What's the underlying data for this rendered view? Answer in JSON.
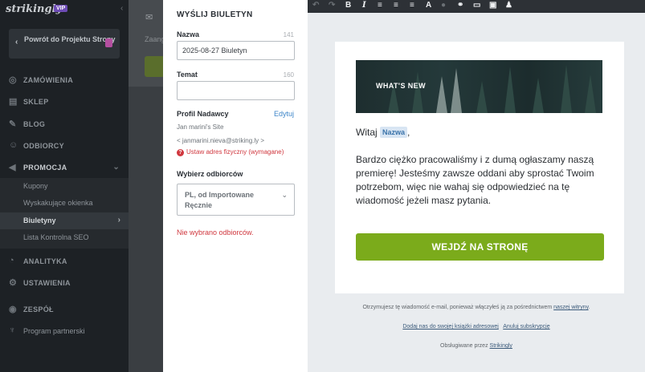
{
  "brand": {
    "name": "strikingly",
    "badge": "VIP"
  },
  "sidebar": {
    "back_label": "Powrót do Projektu Strony",
    "items": [
      {
        "label": "ZAMÓWIENIA",
        "icon": "dollar-icon"
      },
      {
        "label": "SKLEP",
        "icon": "shop-icon"
      },
      {
        "label": "BLOG",
        "icon": "pen-icon"
      },
      {
        "label": "ODBIORCY",
        "icon": "users-icon"
      },
      {
        "label": "PROMOCJA",
        "icon": "megaphone-icon"
      },
      {
        "label": "ANALITYKA",
        "icon": "analytics-icon"
      },
      {
        "label": "USTAWIENIA",
        "icon": "gear-icon"
      },
      {
        "label": "ZESPÓŁ",
        "icon": "team-icon"
      },
      {
        "label": "Program partnerski",
        "icon": "trophy-icon"
      }
    ],
    "sub_items": [
      {
        "label": "Kupony"
      },
      {
        "label": "Wyskakujące okienka"
      },
      {
        "label": "Biuletyny"
      },
      {
        "label": "Lista Kontrolna SEO"
      }
    ]
  },
  "background": {
    "text": "Zaang"
  },
  "form": {
    "title": "WYŚLIJ BIULETYN",
    "name_label": "Nazwa",
    "name_counter": "141",
    "name_value": "2025-08-27 Biuletyn",
    "subject_label": "Temat",
    "subject_counter": "160",
    "subject_value": "",
    "sender_label": "Profil Nadawcy",
    "edit_label": "Edytuj",
    "sender_name": "Jan marini's Site",
    "sender_email": "< janmarini.nieva@striking.ly >",
    "warning": "Ustaw adres fizyczny (wymagane)",
    "recipients_label": "Wybierz odbiorców",
    "recipients_line1": "PL, od Importowane",
    "recipients_line2": "Ręcznie",
    "recipients_error": "Nie wybrano odbiorców."
  },
  "email": {
    "banner_text": "WHAT'S NEW",
    "greeting": "Witaj",
    "name_tag": "Nazwa",
    "greeting_suffix": ",",
    "body": "Bardzo ciężko pracowaliśmy i z dumą ogłaszamy naszą premierę! Jesteśmy zawsze  oddani aby sprostać Twoim potrzebom, więc nie wahaj się odpowiedzieć na tę wiadomość jeżeli masz pytania.",
    "cta_label": "WEJDŹ NA STRONĘ",
    "footer_line1": "Otrzymujesz tę wiadomość e-mail, ponieważ włączyłeś ją za pośrednictwem",
    "footer_link1": "naszej witryny",
    "footer_dot": ".",
    "footer_add": "Dodaj nas do swojej książki adresowej",
    "footer_unsub": "Anuluj subskrypcję",
    "footer_powered": "Obsługiwane przez",
    "footer_powered_link": "Strikingly"
  },
  "colors": {
    "accent_green": "#7bab1b",
    "error_red": "#d0373e",
    "link_blue": "#3e86c9"
  }
}
